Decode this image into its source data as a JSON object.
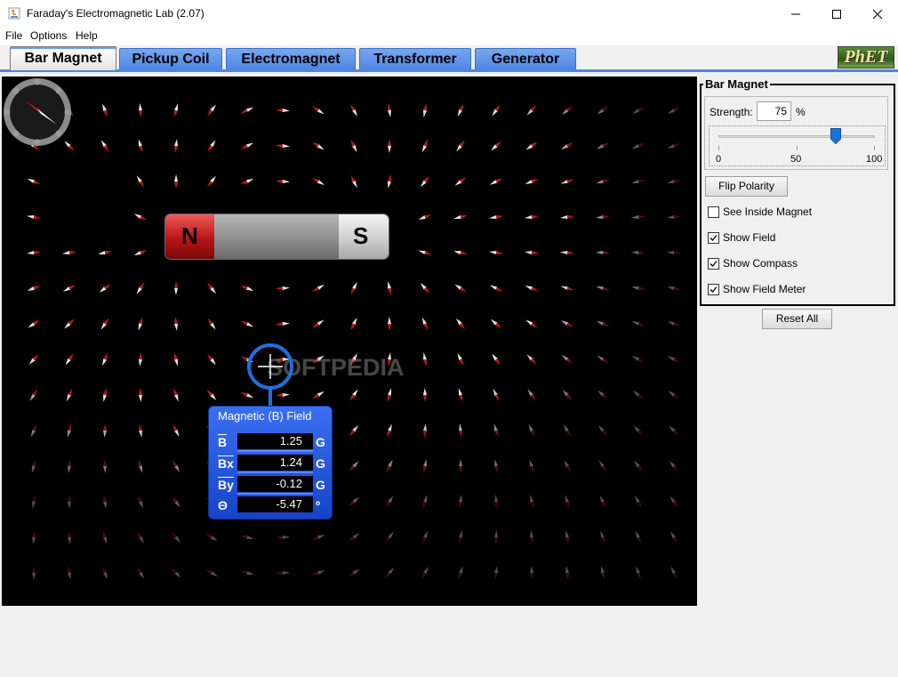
{
  "window": {
    "title": "Faraday's Electromagnetic Lab (2.07)",
    "app_icon": "java-icon",
    "controls": [
      "minimize-icon",
      "maximize-icon",
      "close-icon"
    ]
  },
  "menu": {
    "items": [
      "File",
      "Options",
      "Help"
    ]
  },
  "tabs": {
    "items": [
      "Bar Magnet",
      "Pickup Coil",
      "Electromagnet",
      "Transformer",
      "Generator"
    ],
    "active": "Bar Magnet",
    "logo": "PhET"
  },
  "canvas": {
    "magnet": {
      "north_label": "N",
      "south_label": "S"
    },
    "watermark": "SOFTPEDIA",
    "compass_icon": "compass-icon",
    "field_meter": {
      "title": "Magnetic (B) Field",
      "rows": [
        {
          "label": "B",
          "value": "1.25",
          "unit": "G"
        },
        {
          "label": "Bx",
          "value": "1.24",
          "unit": "G"
        },
        {
          "label": "By",
          "value": "-0.12",
          "unit": "G"
        },
        {
          "label": "Θ",
          "value": "-5.47",
          "unit": "º"
        }
      ]
    }
  },
  "panel": {
    "title": "Bar Magnet",
    "strength_label": "Strength:",
    "strength_value": "75",
    "strength_unit": "%",
    "slider": {
      "min_label": "0",
      "mid_label": "50",
      "max_label": "100",
      "value_percent": 75
    },
    "flip_button": "Flip Polarity",
    "checkboxes": [
      {
        "label": "See Inside Magnet",
        "checked": false
      },
      {
        "label": "Show Field",
        "checked": true
      },
      {
        "label": "Show Compass",
        "checked": true
      },
      {
        "label": "Show Field Meter",
        "checked": true
      }
    ],
    "reset_button": "Reset All"
  },
  "colors": {
    "tab_blue": "#4f86e4",
    "meter_blue": "#1f6fe0",
    "north_red": "#b81414",
    "canvas_bg": "#000000"
  }
}
